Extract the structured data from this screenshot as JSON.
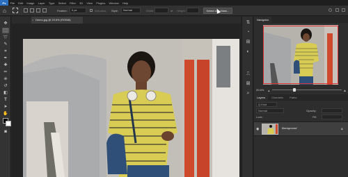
{
  "menubar": {
    "logo": "Ps",
    "items": [
      "File",
      "Edit",
      "Image",
      "Layer",
      "Type",
      "Select",
      "Filter",
      "3D",
      "View",
      "Plugins",
      "Window",
      "Help"
    ]
  },
  "options": {
    "feather_label": "Feather:",
    "feather_value": "0 px",
    "antialias_label": "Anti-alias",
    "style_label": "Style:",
    "style_value": "Normal",
    "width_label": "Width:",
    "height_label": "Height:",
    "select_mask_label": "Select and Mask..."
  },
  "document": {
    "tab_title": "Demo.jpg @ 20.6% (RGB/8)"
  },
  "navigator": {
    "tab_label": "Navigator",
    "zoom_value": "20.6%"
  },
  "layers_panel": {
    "tabs": [
      "Layers",
      "Channels",
      "Paths"
    ],
    "kind_label": "Q Kind",
    "blend_mode": "Normal",
    "opacity_label": "Opacity:",
    "lock_label": "Lock:",
    "fill_label": "Fill:",
    "layer_name": "Background"
  },
  "colors": {
    "accent": "#2a6fc0",
    "sweater": "#d8cc55",
    "stripe": "#3a3a30",
    "jeans": "#2f4f78",
    "door": "#cf4a2c"
  }
}
